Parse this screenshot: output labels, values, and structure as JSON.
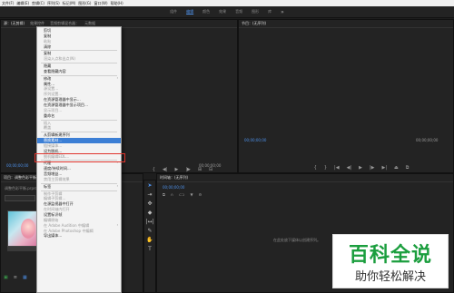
{
  "menubar": [
    "文件(F)",
    "编辑(E)",
    "剪辑(C)",
    "序列(S)",
    "标记(M)",
    "图形(G)",
    "窗口(W)",
    "帮助(H)"
  ],
  "workspace": {
    "tabs": [
      "组件",
      "编辑",
      "颜色",
      "效果",
      "音频",
      "图形",
      "库"
    ],
    "active_index": 1,
    "more": "»"
  },
  "source_panel": {
    "header_tabs": [
      "源：(无剪辑)",
      "效果控件",
      "音频剪辑混合器：",
      "元数据"
    ],
    "timecode_left": "00;00;00;00",
    "timecode_right": "00;00;00;00"
  },
  "program_panel": {
    "header": "节目：(无序列)",
    "timecode_left": "00;00;00;00",
    "timecode_right": "00;00;00;00"
  },
  "project_panel": {
    "header": [
      "项目：调整色彩平衡",
      "媒体浏览器"
    ],
    "path": "调整色彩平衡.prproj"
  },
  "timeline_panel": {
    "header": "时间轴：(无序列)",
    "timecode": "00;00;00;00",
    "empty_text": "在此处放下媒体以创建序列。"
  },
  "context_menu": {
    "highlighted_index": 24,
    "items": [
      {
        "label": "剪切",
        "disabled": false
      },
      {
        "label": "复制",
        "disabled": false
      },
      {
        "label": "粘贴",
        "disabled": true
      },
      {
        "label": "清除",
        "disabled": false
      },
      {
        "sep": true
      },
      {
        "label": "复制",
        "disabled": false
      },
      {
        "label": "渲染入点和出点(N)",
        "disabled": true
      },
      {
        "sep": true
      },
      {
        "label": "隐藏",
        "disabled": false
      },
      {
        "label": "查看隐藏内容",
        "disabled": false
      },
      {
        "sep": true
      },
      {
        "label": "修改",
        "disabled": false,
        "submenu": true
      },
      {
        "label": "属性...",
        "disabled": false
      },
      {
        "label": "源设置...",
        "disabled": true
      },
      {
        "label": "序列设置...",
        "disabled": true
      },
      {
        "label": "在资源管理器中显示...",
        "disabled": false
      },
      {
        "label": "在资源管理器中显示项目...",
        "disabled": false
      },
      {
        "label": "显示项目...",
        "disabled": true
      },
      {
        "label": "重命名",
        "disabled": false
      },
      {
        "sep": true
      },
      {
        "label": "插入",
        "disabled": true
      },
      {
        "label": "覆盖",
        "disabled": true
      },
      {
        "sep": true
      },
      {
        "label": "从剪辑新建序列",
        "disabled": false
      },
      {
        "label": "替换素材...",
        "disabled": false
      },
      {
        "label": "链接媒体...",
        "disabled": true
      },
      {
        "label": "设为脱机...",
        "disabled": false
      },
      {
        "label": "脱机编辑EDL...",
        "disabled": true
      },
      {
        "sep": true
      },
      {
        "label": "代理",
        "disabled": false,
        "submenu": true
      },
      {
        "label": "速度/持续时间...",
        "disabled": false
      },
      {
        "label": "音频增益...",
        "disabled": false
      },
      {
        "label": "禁用主剪辑效果",
        "disabled": true
      },
      {
        "sep": true
      },
      {
        "label": "标签",
        "disabled": false,
        "submenu": true
      },
      {
        "sep": true
      },
      {
        "label": "制作子剪辑",
        "disabled": true
      },
      {
        "label": "编辑子剪辑...",
        "disabled": true
      },
      {
        "label": "在源监视器中打开",
        "disabled": false
      },
      {
        "label": "在时间轴内打开",
        "disabled": true
      },
      {
        "label": "设置标识帧",
        "disabled": false
      },
      {
        "label": "编辑原始",
        "disabled": true
      },
      {
        "label": "在 Adobe Audition 中编辑",
        "disabled": true,
        "submenu": true
      },
      {
        "label": "在 Adobe Photoshop 中编辑",
        "disabled": true
      },
      {
        "label": "导出媒体...",
        "disabled": false
      }
    ]
  },
  "watermark": {
    "title": "百科全说",
    "subtitle": "助你轻松解决"
  }
}
